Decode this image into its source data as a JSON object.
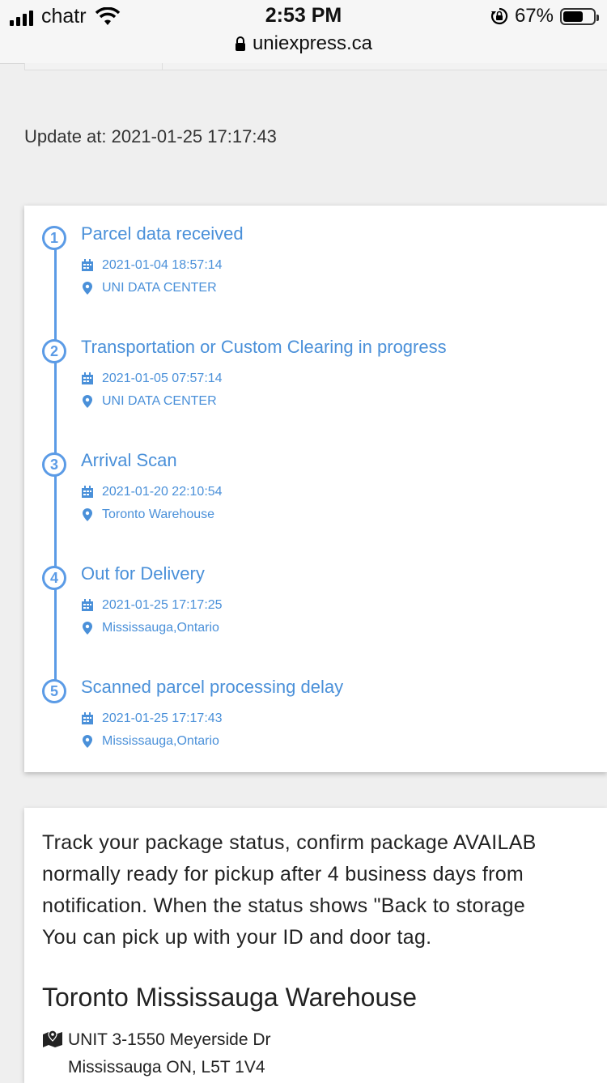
{
  "status_bar": {
    "carrier": "chatr",
    "time": "2:53 PM",
    "battery_percent": "67%",
    "battery_level": 0.67,
    "url": "uniexpress.ca"
  },
  "update": {
    "text": "Update at: 2021-01-25 17:17:43"
  },
  "timeline": [
    {
      "num": "1",
      "title": "Parcel data received",
      "date": "2021-01-04 18:57:14",
      "location": "UNI DATA CENTER"
    },
    {
      "num": "2",
      "title": "Transportation or Custom Clearing in progress",
      "date": "2021-01-05 07:57:14",
      "location": "UNI DATA CENTER"
    },
    {
      "num": "3",
      "title": "Arrival Scan",
      "date": "2021-01-20 22:10:54",
      "location": "Toronto Warehouse"
    },
    {
      "num": "4",
      "title": "Out for Delivery",
      "date": "2021-01-25 17:17:25",
      "location": "Mississauga,Ontario"
    },
    {
      "num": "5",
      "title": "Scanned parcel processing delay",
      "date": "2021-01-25 17:17:43",
      "location": "Mississauga,Ontario"
    }
  ],
  "info": {
    "lines": [
      "Track your package status, confirm package AVAILAB",
      "normally ready for pickup after 4 business days from",
      "notification. When the status shows \"Back to storage",
      "You can pick up with your ID and door tag."
    ],
    "warehouse_title": "Toronto Mississauga Warehouse",
    "address_line1": "UNIT 3-1550 Meyerside Dr",
    "address_line2": "Mississauga ON, L5T 1V4"
  },
  "colors": {
    "accent": "#4a90d9",
    "timeline": "#5b9be6",
    "background": "#efefef"
  }
}
